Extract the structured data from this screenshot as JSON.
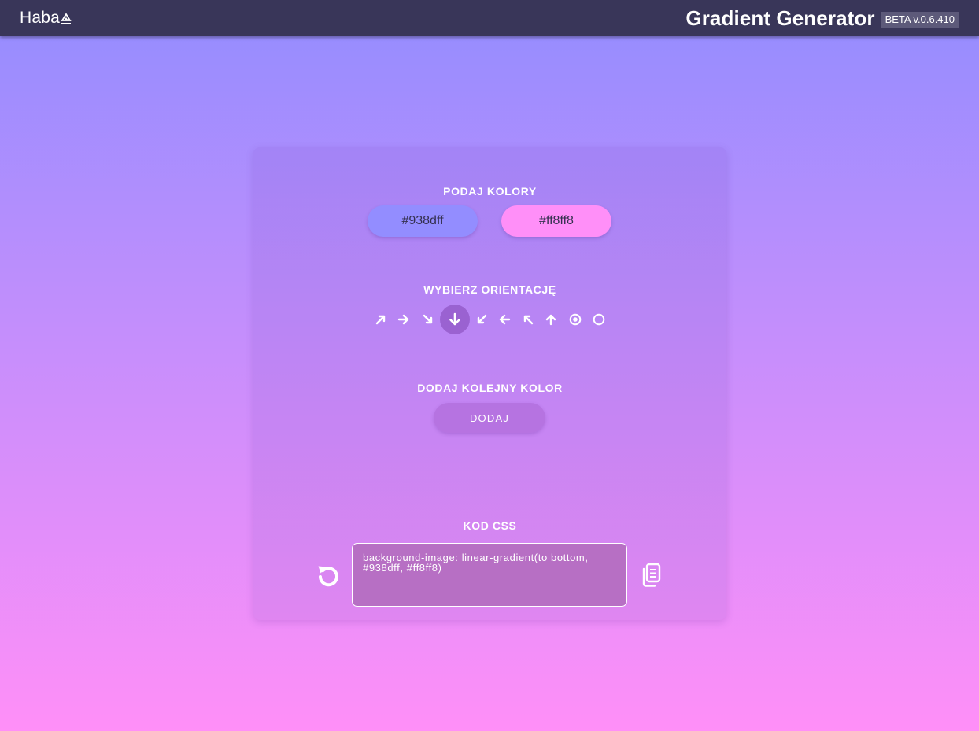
{
  "header": {
    "logo_text": "Haba",
    "title": "Gradient Generator",
    "version": "BETA v.0.6.410"
  },
  "colors": {
    "title": "PODAJ KOLORY",
    "items": [
      {
        "value": "#938dff",
        "bg": "#938dff"
      },
      {
        "value": "#ff8ff8",
        "bg": "#ff8ff8"
      }
    ]
  },
  "orientation": {
    "title": "WYBIERZ ORIENTACJĘ",
    "options": [
      {
        "icon": "arrow-up-right-icon"
      },
      {
        "icon": "arrow-right-icon"
      },
      {
        "icon": "arrow-down-right-icon"
      },
      {
        "icon": "arrow-down-icon",
        "selected": true
      },
      {
        "icon": "arrow-down-left-icon"
      },
      {
        "icon": "arrow-left-icon"
      },
      {
        "icon": "arrow-up-left-icon"
      },
      {
        "icon": "arrow-up-icon"
      },
      {
        "icon": "radial-center-icon"
      },
      {
        "icon": "circle-icon"
      }
    ]
  },
  "add_color": {
    "title": "DODAJ KOLEJNY KOLOR",
    "button_label": "DODAJ"
  },
  "css_code": {
    "title": "KOD CSS",
    "code": "background-image: linear-gradient(to bottom, #938dff, #ff8ff8)",
    "reset_icon": "reset-icon",
    "copy_icon": "copy-icon"
  },
  "theme": {
    "topbar": "#393659",
    "gradient_start": "#938dff",
    "gradient_end": "#ff8ff8"
  }
}
